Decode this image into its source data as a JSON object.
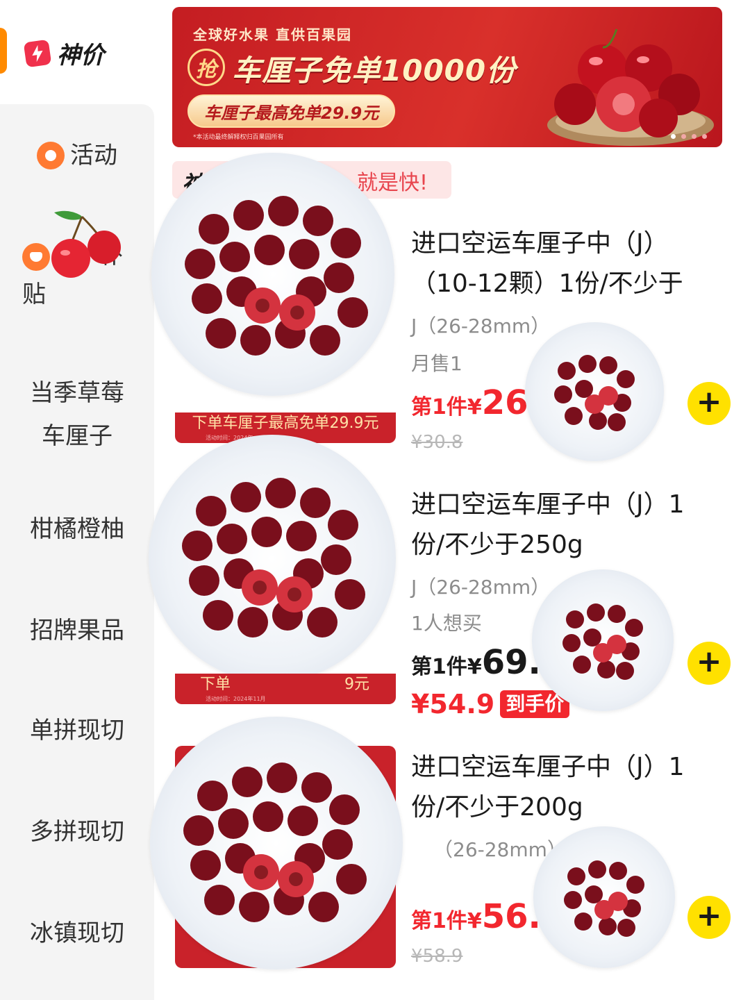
{
  "sidebar": {
    "brand": "神价",
    "items": {
      "activity": "活动",
      "subsidy": "补贴",
      "cat1_line1": "当季草莓",
      "cat1_line2": "车厘子",
      "cat2": "柑橘橙柚",
      "cat3": "招牌果品",
      "cat4": "单拼现切",
      "cat5": "多拼现切",
      "cat6": "冰镇现切"
    }
  },
  "banner": {
    "kicker": "全球好水果 直供百果园",
    "grab": "抢",
    "headline": "车厘子免单10000份",
    "pill": "车厘子最高免单29.9元",
    "note": "*本活动最终解释权归百果园所有"
  },
  "promo": {
    "logo": "神",
    "text": "就是快!"
  },
  "products": [
    {
      "title": "进口空运车厘子中（J）（10-12颗）1份/不少于",
      "spec": "J（26-28mm）",
      "sold": "月售1",
      "price_label": "第1件¥",
      "price_value": "26.",
      "old_price": "¥30.8",
      "ribbon": "下单车厘子最高免单29.9元",
      "ribbon_note": "活动时间：2024年"
    },
    {
      "title": "进口空运车厘子中（J）1份/不少于250g",
      "spec": "J（26-28mm）",
      "sold": "1人想买",
      "price_label": "第1件¥",
      "price_value": "69.9",
      "hand_price": "¥54.9",
      "hand_tag": "到手价",
      "ribbon": "下单",
      "ribbon_tail": "9元",
      "ribbon_note": "活动时间：2024年11月"
    },
    {
      "title": "进口空运车厘子中（J）1份/不少于200g",
      "spec": "（26-28mm）",
      "price_label": "第1件¥",
      "price_value": "56.9",
      "old_price": "¥58.9"
    }
  ],
  "colors": {
    "accent": "#ff8a00",
    "price_red": "#f2272e",
    "add_button": "#ffe100",
    "banner_red": "#c41d22"
  }
}
